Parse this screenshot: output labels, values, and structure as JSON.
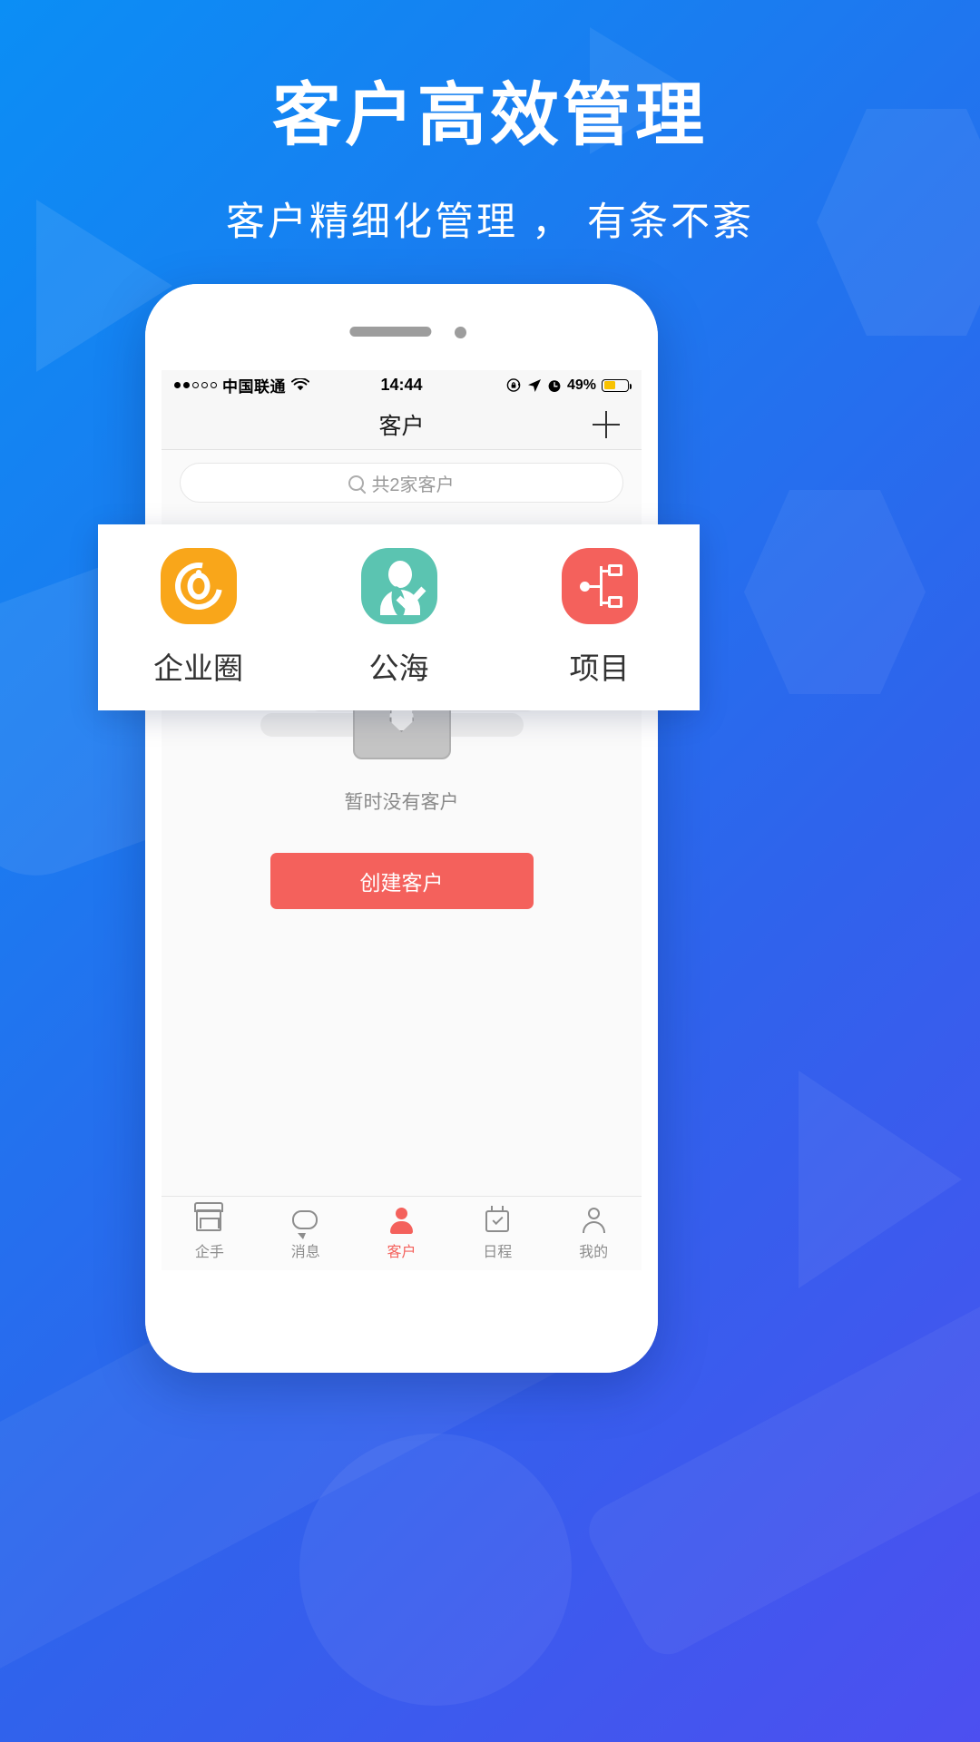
{
  "promo": {
    "title": "客户高效管理",
    "subtitle": "客户精细化管理 ， 有条不紊",
    "bg_gradient_start": "#0b8ef5",
    "bg_gradient_end": "#4d4ff0"
  },
  "phone": {
    "status_bar": {
      "carrier": "中国联通",
      "signal_filled": 2,
      "signal_total": 5,
      "time": "14:44",
      "battery_percent": "49%",
      "battery_level": 49,
      "battery_color": "#f8c200",
      "icons": [
        "wifi-icon",
        "rotation-lock-icon",
        "location-arrow-icon",
        "alarm-clock-icon"
      ]
    },
    "nav": {
      "title": "客户",
      "add_button": "+"
    },
    "search": {
      "placeholder": "共2家客户",
      "icon": "search-icon"
    },
    "empty_state": {
      "illustration": "clipboard-necktie-illustration",
      "message": "暂时没有客户",
      "cta_label": "创建客户",
      "cta_color": "#f4615c"
    },
    "tabbar": {
      "items": [
        {
          "label": "企手",
          "icon": "shop-icon",
          "active": false
        },
        {
          "label": "消息",
          "icon": "chat-bubble-icon",
          "active": false
        },
        {
          "label": "客户",
          "icon": "person-filled-icon",
          "active": true
        },
        {
          "label": "日程",
          "icon": "calendar-check-icon",
          "active": false
        },
        {
          "label": "我的",
          "icon": "person-outline-icon",
          "active": false
        }
      ],
      "active_color": "#f4615c",
      "inactive_color": "#8d8d8d"
    }
  },
  "action_panel": {
    "items": [
      {
        "label": "企业圈",
        "icon": "spiral-circle-icon",
        "color": "#f9a61a"
      },
      {
        "label": "公海",
        "icon": "person-check-icon",
        "color": "#5bc4b1"
      },
      {
        "label": "项目",
        "icon": "project-tree-icon",
        "color": "#f4615c"
      }
    ]
  }
}
